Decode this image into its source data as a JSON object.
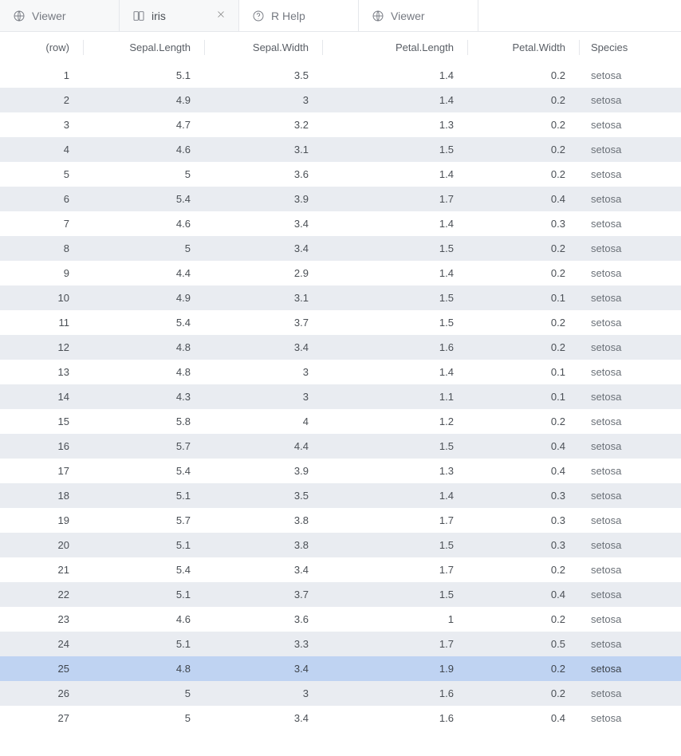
{
  "tabs": [
    {
      "label": "Viewer",
      "icon": "globe",
      "closeable": false,
      "active": false
    },
    {
      "label": "iris",
      "icon": "data",
      "closeable": true,
      "active": true
    },
    {
      "label": "R Help",
      "icon": "help",
      "closeable": false,
      "active": false
    },
    {
      "label": "Viewer",
      "icon": "globe",
      "closeable": false,
      "active": false
    }
  ],
  "table": {
    "headers": {
      "row": "(row)",
      "sepal_length": "Sepal.Length",
      "sepal_width": "Sepal.Width",
      "petal_length": "Petal.Length",
      "petal_width": "Petal.Width",
      "species": "Species"
    },
    "selected_row": 25,
    "rows": [
      {
        "row": 1,
        "sepal_length": "5.1",
        "sepal_width": "3.5",
        "petal_length": "1.4",
        "petal_width": "0.2",
        "species": "setosa"
      },
      {
        "row": 2,
        "sepal_length": "4.9",
        "sepal_width": "3",
        "petal_length": "1.4",
        "petal_width": "0.2",
        "species": "setosa"
      },
      {
        "row": 3,
        "sepal_length": "4.7",
        "sepal_width": "3.2",
        "petal_length": "1.3",
        "petal_width": "0.2",
        "species": "setosa"
      },
      {
        "row": 4,
        "sepal_length": "4.6",
        "sepal_width": "3.1",
        "petal_length": "1.5",
        "petal_width": "0.2",
        "species": "setosa"
      },
      {
        "row": 5,
        "sepal_length": "5",
        "sepal_width": "3.6",
        "petal_length": "1.4",
        "petal_width": "0.2",
        "species": "setosa"
      },
      {
        "row": 6,
        "sepal_length": "5.4",
        "sepal_width": "3.9",
        "petal_length": "1.7",
        "petal_width": "0.4",
        "species": "setosa"
      },
      {
        "row": 7,
        "sepal_length": "4.6",
        "sepal_width": "3.4",
        "petal_length": "1.4",
        "petal_width": "0.3",
        "species": "setosa"
      },
      {
        "row": 8,
        "sepal_length": "5",
        "sepal_width": "3.4",
        "petal_length": "1.5",
        "petal_width": "0.2",
        "species": "setosa"
      },
      {
        "row": 9,
        "sepal_length": "4.4",
        "sepal_width": "2.9",
        "petal_length": "1.4",
        "petal_width": "0.2",
        "species": "setosa"
      },
      {
        "row": 10,
        "sepal_length": "4.9",
        "sepal_width": "3.1",
        "petal_length": "1.5",
        "petal_width": "0.1",
        "species": "setosa"
      },
      {
        "row": 11,
        "sepal_length": "5.4",
        "sepal_width": "3.7",
        "petal_length": "1.5",
        "petal_width": "0.2",
        "species": "setosa"
      },
      {
        "row": 12,
        "sepal_length": "4.8",
        "sepal_width": "3.4",
        "petal_length": "1.6",
        "petal_width": "0.2",
        "species": "setosa"
      },
      {
        "row": 13,
        "sepal_length": "4.8",
        "sepal_width": "3",
        "petal_length": "1.4",
        "petal_width": "0.1",
        "species": "setosa"
      },
      {
        "row": 14,
        "sepal_length": "4.3",
        "sepal_width": "3",
        "petal_length": "1.1",
        "petal_width": "0.1",
        "species": "setosa"
      },
      {
        "row": 15,
        "sepal_length": "5.8",
        "sepal_width": "4",
        "petal_length": "1.2",
        "petal_width": "0.2",
        "species": "setosa"
      },
      {
        "row": 16,
        "sepal_length": "5.7",
        "sepal_width": "4.4",
        "petal_length": "1.5",
        "petal_width": "0.4",
        "species": "setosa"
      },
      {
        "row": 17,
        "sepal_length": "5.4",
        "sepal_width": "3.9",
        "petal_length": "1.3",
        "petal_width": "0.4",
        "species": "setosa"
      },
      {
        "row": 18,
        "sepal_length": "5.1",
        "sepal_width": "3.5",
        "petal_length": "1.4",
        "petal_width": "0.3",
        "species": "setosa"
      },
      {
        "row": 19,
        "sepal_length": "5.7",
        "sepal_width": "3.8",
        "petal_length": "1.7",
        "petal_width": "0.3",
        "species": "setosa"
      },
      {
        "row": 20,
        "sepal_length": "5.1",
        "sepal_width": "3.8",
        "petal_length": "1.5",
        "petal_width": "0.3",
        "species": "setosa"
      },
      {
        "row": 21,
        "sepal_length": "5.4",
        "sepal_width": "3.4",
        "petal_length": "1.7",
        "petal_width": "0.2",
        "species": "setosa"
      },
      {
        "row": 22,
        "sepal_length": "5.1",
        "sepal_width": "3.7",
        "petal_length": "1.5",
        "petal_width": "0.4",
        "species": "setosa"
      },
      {
        "row": 23,
        "sepal_length": "4.6",
        "sepal_width": "3.6",
        "petal_length": "1",
        "petal_width": "0.2",
        "species": "setosa"
      },
      {
        "row": 24,
        "sepal_length": "5.1",
        "sepal_width": "3.3",
        "petal_length": "1.7",
        "petal_width": "0.5",
        "species": "setosa"
      },
      {
        "row": 25,
        "sepal_length": "4.8",
        "sepal_width": "3.4",
        "petal_length": "1.9",
        "petal_width": "0.2",
        "species": "setosa"
      },
      {
        "row": 26,
        "sepal_length": "5",
        "sepal_width": "3",
        "petal_length": "1.6",
        "petal_width": "0.2",
        "species": "setosa"
      },
      {
        "row": 27,
        "sepal_length": "5",
        "sepal_width": "3.4",
        "petal_length": "1.6",
        "petal_width": "0.4",
        "species": "setosa"
      }
    ]
  }
}
